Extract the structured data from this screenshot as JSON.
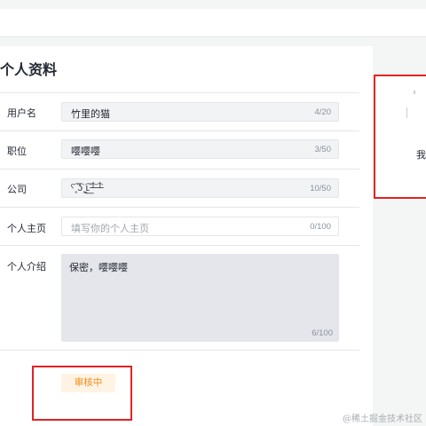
{
  "page": {
    "title": "个人资料",
    "side_char": "我",
    "watermark": "@稀土掘金技术社区"
  },
  "form": {
    "username": {
      "label": "用户名",
      "value": "竹里的猫",
      "count": "4/20"
    },
    "position": {
      "label": "职位",
      "value": "嘤嘤嘤",
      "count": "3/50"
    },
    "company": {
      "label": "公司",
      "value": "ˁ͡˳͡ʖ˳̭͡ʟ͟͡┴͡┴",
      "count": "10/50"
    },
    "homepage": {
      "label": "个人主页",
      "placeholder": "填写你的个人主页",
      "count": "0/100"
    },
    "intro": {
      "label": "个人介绍",
      "value": "保密，嘤嘤嘤",
      "count": "6/100"
    }
  },
  "status": {
    "label": "审核中"
  },
  "colors": {
    "status_bg": "#fff4e3",
    "status_text": "#f08c1a",
    "highlight_border": "#e02323"
  }
}
